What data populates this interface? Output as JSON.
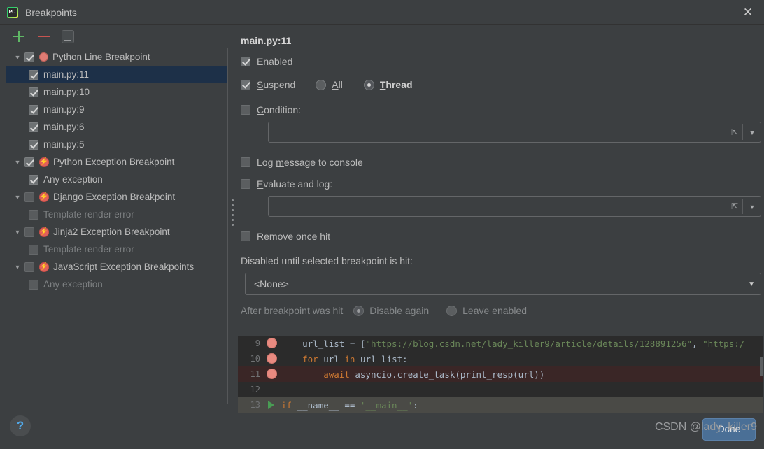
{
  "window": {
    "title": "Breakpoints",
    "logo_icon": "pycharm-logo-icon",
    "close_icon": "close-icon"
  },
  "toolbar": {
    "add_icon": "plus-icon",
    "remove_icon": "minus-icon",
    "muted_icon": "document-icon"
  },
  "tree": {
    "items": [
      {
        "label": "Python Line Breakpoint",
        "level": 0,
        "twisty": "▼",
        "checked": true,
        "icon": "breakpoint-dot-icon",
        "dim": false,
        "selected": false
      },
      {
        "label": "main.py:11",
        "level": 1,
        "twisty": "",
        "checked": true,
        "icon": "",
        "dim": false,
        "selected": true
      },
      {
        "label": "main.py:10",
        "level": 1,
        "twisty": "",
        "checked": true,
        "icon": "",
        "dim": false,
        "selected": false
      },
      {
        "label": "main.py:9",
        "level": 1,
        "twisty": "",
        "checked": true,
        "icon": "",
        "dim": false,
        "selected": false
      },
      {
        "label": "main.py:6",
        "level": 1,
        "twisty": "",
        "checked": true,
        "icon": "",
        "dim": false,
        "selected": false
      },
      {
        "label": "main.py:5",
        "level": 1,
        "twisty": "",
        "checked": true,
        "icon": "",
        "dim": false,
        "selected": false
      },
      {
        "label": "Python Exception Breakpoint",
        "level": 0,
        "twisty": "▼",
        "checked": true,
        "icon": "exception-breakpoint-icon",
        "dim": false,
        "selected": false
      },
      {
        "label": "Any exception",
        "level": 1,
        "twisty": "",
        "checked": true,
        "icon": "",
        "dim": false,
        "selected": false
      },
      {
        "label": "Django Exception Breakpoint",
        "level": 0,
        "twisty": "▼",
        "checked": false,
        "icon": "exception-breakpoint-icon",
        "dim": false,
        "selected": false
      },
      {
        "label": "Template render error",
        "level": 1,
        "twisty": "",
        "checked": false,
        "icon": "",
        "dim": true,
        "selected": false
      },
      {
        "label": "Jinja2 Exception Breakpoint",
        "level": 0,
        "twisty": "▼",
        "checked": false,
        "icon": "exception-breakpoint-icon",
        "dim": false,
        "selected": false
      },
      {
        "label": "Template render error",
        "level": 1,
        "twisty": "",
        "checked": false,
        "icon": "",
        "dim": true,
        "selected": false
      },
      {
        "label": "JavaScript Exception Breakpoints",
        "level": 0,
        "twisty": "▼",
        "checked": false,
        "icon": "exception-breakpoint-icon",
        "dim": false,
        "selected": false
      },
      {
        "label": "Any exception",
        "level": 1,
        "twisty": "",
        "checked": false,
        "icon": "",
        "dim": true,
        "selected": false
      }
    ]
  },
  "details": {
    "title": "main.py:11",
    "enabled": {
      "label": "Enabled",
      "mnemonic": "d",
      "checked": true
    },
    "suspend": {
      "label": "Suspend",
      "mnemonic": "S",
      "checked": true
    },
    "suspend_all": {
      "label": "All",
      "mnemonic": "A",
      "selected": false
    },
    "suspend_thread": {
      "label": "Thread",
      "mnemonic": "T",
      "selected": true
    },
    "condition": {
      "label": "Condition:",
      "mnemonic": "C",
      "checked": false,
      "value": "",
      "expand_icon": "expand-icon",
      "chevron_icon": "chevron-down-icon"
    },
    "log_message": {
      "label": "Log message to console",
      "mnemonic": "m",
      "checked": false
    },
    "evaluate_and_log": {
      "label": "Evaluate and log:",
      "mnemonic": "E",
      "checked": false,
      "value": "",
      "expand_icon": "expand-icon",
      "chevron_icon": "chevron-down-icon"
    },
    "remove_once_hit": {
      "label": "Remove once hit",
      "mnemonic": "R",
      "checked": false
    },
    "disabled_until": {
      "label": "Disabled until selected breakpoint is hit:",
      "selected_option": "<None>",
      "chevron_icon": "chevron-down-icon"
    },
    "after_hit": {
      "label": "After breakpoint was hit",
      "disable_again": {
        "label": "Disable again",
        "selected": true
      },
      "leave_enabled": {
        "label": "Leave enabled",
        "selected": false
      }
    }
  },
  "code_preview": {
    "lines": [
      {
        "num": "9",
        "marker": "breakpoint-dot-icon",
        "highlight": false,
        "current": false,
        "segments": [
          {
            "t": "    url_list = [",
            "c": "plain"
          },
          {
            "t": "\"https://blog.csdn.net/lady_killer9/article/details/128891256\"",
            "c": "string"
          },
          {
            "t": ", ",
            "c": "plain"
          },
          {
            "t": "\"https:/",
            "c": "string"
          }
        ]
      },
      {
        "num": "10",
        "marker": "breakpoint-dot-icon",
        "highlight": false,
        "current": false,
        "segments": [
          {
            "t": "    ",
            "c": "plain"
          },
          {
            "t": "for",
            "c": "keyword"
          },
          {
            "t": " url ",
            "c": "plain"
          },
          {
            "t": "in",
            "c": "keyword"
          },
          {
            "t": " url_list:",
            "c": "plain"
          }
        ]
      },
      {
        "num": "11",
        "marker": "breakpoint-dot-icon",
        "highlight": true,
        "current": false,
        "segments": [
          {
            "t": "        ",
            "c": "plain"
          },
          {
            "t": "await",
            "c": "keyword"
          },
          {
            "t": " asyncio.create_task(print_resp(url))",
            "c": "plain"
          }
        ]
      },
      {
        "num": "12",
        "marker": "",
        "highlight": false,
        "current": false,
        "segments": [
          {
            "t": "",
            "c": "plain"
          }
        ]
      },
      {
        "num": "13",
        "marker": "run-arrow-icon",
        "highlight": false,
        "current": true,
        "segments": [
          {
            "t": "",
            "c": "plain"
          },
          {
            "t": "if",
            "c": "keyword"
          },
          {
            "t": " __name__ == ",
            "c": "plain"
          },
          {
            "t": "'__main__'",
            "c": "string"
          },
          {
            "t": ":",
            "c": "plain"
          }
        ]
      }
    ]
  },
  "footer": {
    "help_label": "?",
    "done_label": "Done",
    "watermark": "CSDN @lady_killer9"
  }
}
